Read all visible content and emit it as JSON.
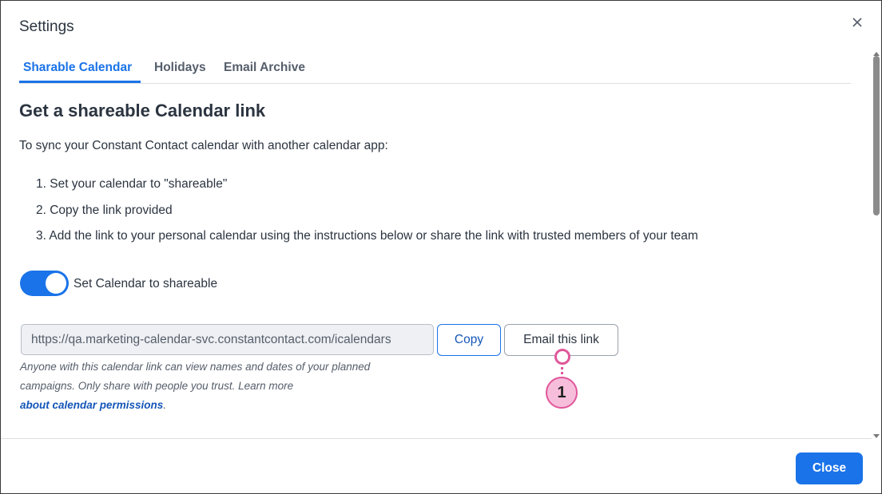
{
  "dialog": {
    "title": "Settings",
    "close_icon": "close-icon"
  },
  "tabs": [
    {
      "label": "Sharable Calendar",
      "active": true
    },
    {
      "label": "Holidays",
      "active": false
    },
    {
      "label": "Email Archive",
      "active": false
    }
  ],
  "content": {
    "heading": "Get a shareable Calendar link",
    "intro": "To sync your Constant Contact calendar with another calendar app:",
    "steps": [
      "1. Set your calendar to \"shareable\"",
      "2. Copy the link provided",
      "3. Add the link to your personal calendar using the instructions below or share the link with trusted members of your team"
    ],
    "toggle": {
      "label": "Set Calendar to shareable",
      "checked": true
    },
    "link": {
      "value": "https://qa.marketing-calendar-svc.constantcontact.com/icalendars"
    },
    "copy_label": "Copy",
    "email_label": "Email this link",
    "note": "Anyone with this calendar link can view names and dates of your planned campaigns. Only share with people you trust. Learn more",
    "note_link": "about calendar permissions",
    "note_end": "."
  },
  "callout": {
    "number": "1"
  },
  "footer": {
    "close_label": "Close"
  },
  "colors": {
    "accent": "#1a73e8",
    "callout": "#e0579a"
  }
}
